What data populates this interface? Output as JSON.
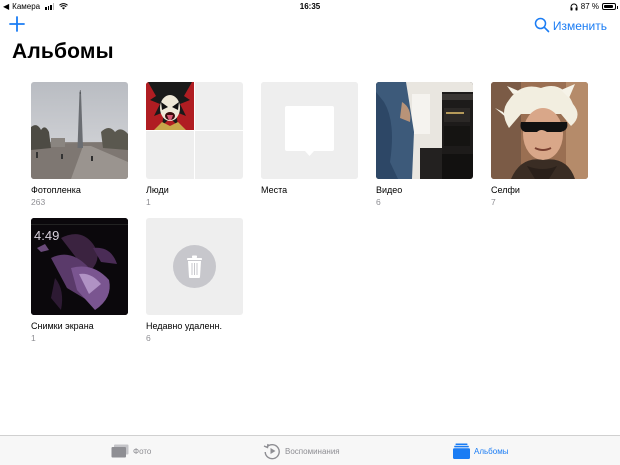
{
  "status_bar": {
    "back_app": "Камера",
    "time": "16:35",
    "battery_percent": "87 %",
    "battery_level": 0.87
  },
  "nav": {
    "add_icon": "plus-icon",
    "search_icon": "search-icon",
    "edit_label": "Изменить",
    "accent_color": "#1a7cf4"
  },
  "page_title": "Альбомы",
  "albums": [
    {
      "title": "Фотопленка",
      "count": "263"
    },
    {
      "title": "Люди",
      "count": "1"
    },
    {
      "title": "Места",
      "count": ""
    },
    {
      "title": "Видео",
      "count": "6"
    },
    {
      "title": "Селфи",
      "count": "7"
    },
    {
      "title": "Снимки экрана",
      "count": "1"
    },
    {
      "title": "Недавно удаленн.",
      "count": "6"
    }
  ],
  "screenshot_thumb_clock": "4:49",
  "tabs": [
    {
      "label": "Фото",
      "icon": "photos-icon",
      "active": false
    },
    {
      "label": "Воспоминания",
      "icon": "memories-icon",
      "active": false
    },
    {
      "label": "Альбомы",
      "icon": "albums-icon",
      "active": true
    }
  ]
}
